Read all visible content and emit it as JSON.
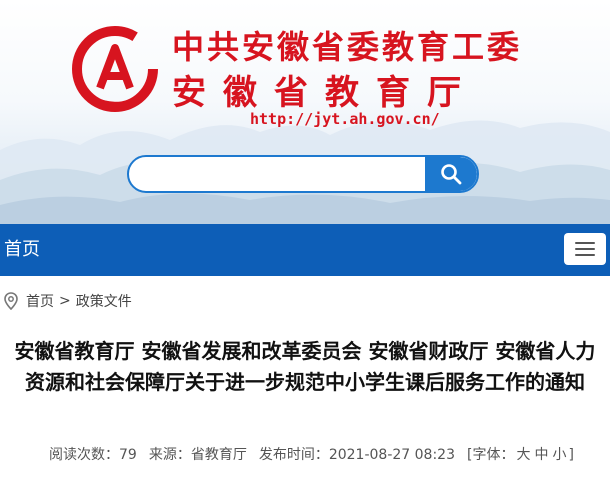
{
  "header": {
    "title_line1": "中共安徽省委教育工委",
    "title_line2": "安徽省教育厅",
    "url": "http://jyt.ah.gov.cn/",
    "brand_color": "#d7141f"
  },
  "search": {
    "value": "",
    "placeholder": "",
    "accent_color": "#1d79cf"
  },
  "nav": {
    "home_label": "首页",
    "bar_color": "#0d5eb7",
    "menu_icon": "hamburger-menu-icon"
  },
  "breadcrumb": {
    "icon": "location-pin-icon",
    "home": "首页",
    "separator": ">",
    "current": "政策文件"
  },
  "article": {
    "title": "安徽省教育厅 安徽省发展和改革委员会 安徽省财政厅 安徽省人力资源和社会保障厅关于进一步规范中小学生课后服务工作的通知",
    "views_label": "阅读次数：79",
    "source_label": "来源：省教育厅",
    "date_label": "发布时间：2021-08-27 08:23",
    "font_open": "[字体：",
    "font_large": "大",
    "font_medium": "中",
    "font_small": "小",
    "font_close": "]"
  }
}
